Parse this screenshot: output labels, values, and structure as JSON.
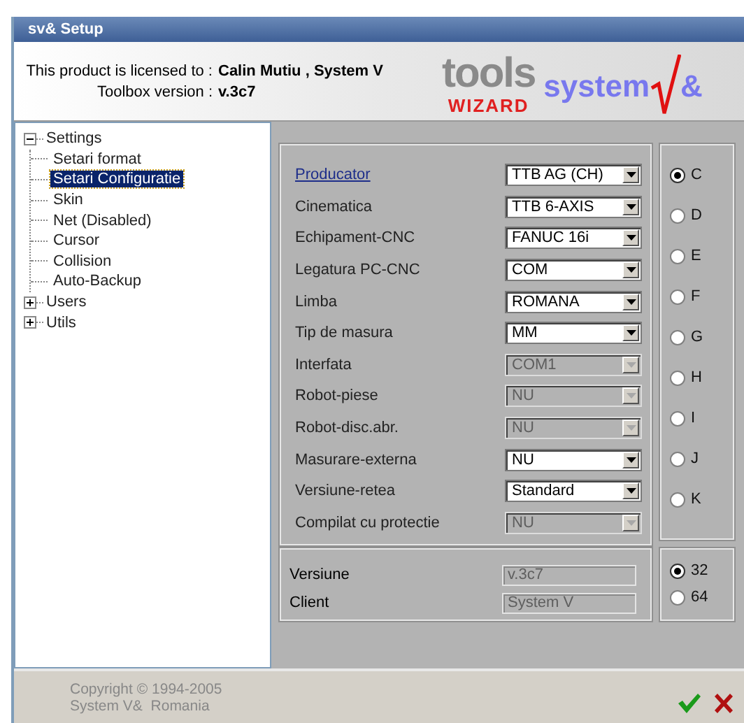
{
  "window": {
    "title": "sv& Setup"
  },
  "header": {
    "license_label": "This product is licensed to :",
    "license_value": "Calin Mutiu , System V",
    "version_label": "Toolbox version :",
    "version_value": "v.3c7",
    "logo": {
      "tools": "tools",
      "wizard": "WIZARD",
      "system": "system",
      "amp": "&"
    }
  },
  "tree": [
    {
      "label": "Settings",
      "expanded": true,
      "selected": false,
      "children": [
        {
          "label": "Setari format",
          "selected": false
        },
        {
          "label": "Setari Configuratie",
          "selected": true
        },
        {
          "label": "Skin",
          "selected": false
        },
        {
          "label": "Net (Disabled)",
          "selected": false
        },
        {
          "label": "Cursor",
          "selected": false
        },
        {
          "label": "Collision",
          "selected": false
        },
        {
          "label": "Auto-Backup",
          "selected": false
        }
      ]
    },
    {
      "label": "Users",
      "expanded": false,
      "selected": false
    },
    {
      "label": "Utils",
      "expanded": false,
      "selected": false
    }
  ],
  "form": [
    {
      "label": "Producator",
      "kind": "link",
      "value": "TTB AG (CH)",
      "disabled": false
    },
    {
      "label": "Cinematica",
      "kind": "text",
      "value": "TTB 6-AXIS",
      "disabled": false
    },
    {
      "label": "Echipament-CNC",
      "kind": "text",
      "value": "FANUC 16i",
      "disabled": false
    },
    {
      "label": "Legatura PC-CNC",
      "kind": "text",
      "value": "COM",
      "disabled": false
    },
    {
      "label": "Limba",
      "kind": "text",
      "value": "ROMANA",
      "disabled": false
    },
    {
      "label": "Tip de masura",
      "kind": "text",
      "value": "MM",
      "disabled": false
    },
    {
      "label": "Interfata",
      "kind": "text",
      "value": "COM1",
      "disabled": true
    },
    {
      "label": "Robot-piese",
      "kind": "text",
      "value": "NU",
      "disabled": true
    },
    {
      "label": "Robot-disc.abr.",
      "kind": "text",
      "value": "NU",
      "disabled": true
    },
    {
      "label": "Masurare-externa",
      "kind": "text",
      "value": "NU",
      "disabled": false
    },
    {
      "label": "Versiune-retea",
      "kind": "text",
      "value": "Standard",
      "disabled": false
    },
    {
      "label": "Compilat cu protectie",
      "kind": "text",
      "value": "NU",
      "disabled": true
    }
  ],
  "drives": [
    {
      "label": "C",
      "selected": true
    },
    {
      "label": "D",
      "selected": false
    },
    {
      "label": "E",
      "selected": false
    },
    {
      "label": "F",
      "selected": false
    },
    {
      "label": "G",
      "selected": false
    },
    {
      "label": "H",
      "selected": false
    },
    {
      "label": "I",
      "selected": false
    },
    {
      "label": "J",
      "selected": false
    },
    {
      "label": "K",
      "selected": false
    }
  ],
  "info": [
    {
      "label": "Versiune",
      "value": "v.3c7"
    },
    {
      "label": "Client",
      "value": "System V"
    }
  ],
  "bits": [
    {
      "label": "32",
      "selected": true
    },
    {
      "label": "64",
      "selected": false
    }
  ],
  "footer": {
    "copyright": "Copyright © 1994-2005",
    "company": "System V&  Romania"
  }
}
